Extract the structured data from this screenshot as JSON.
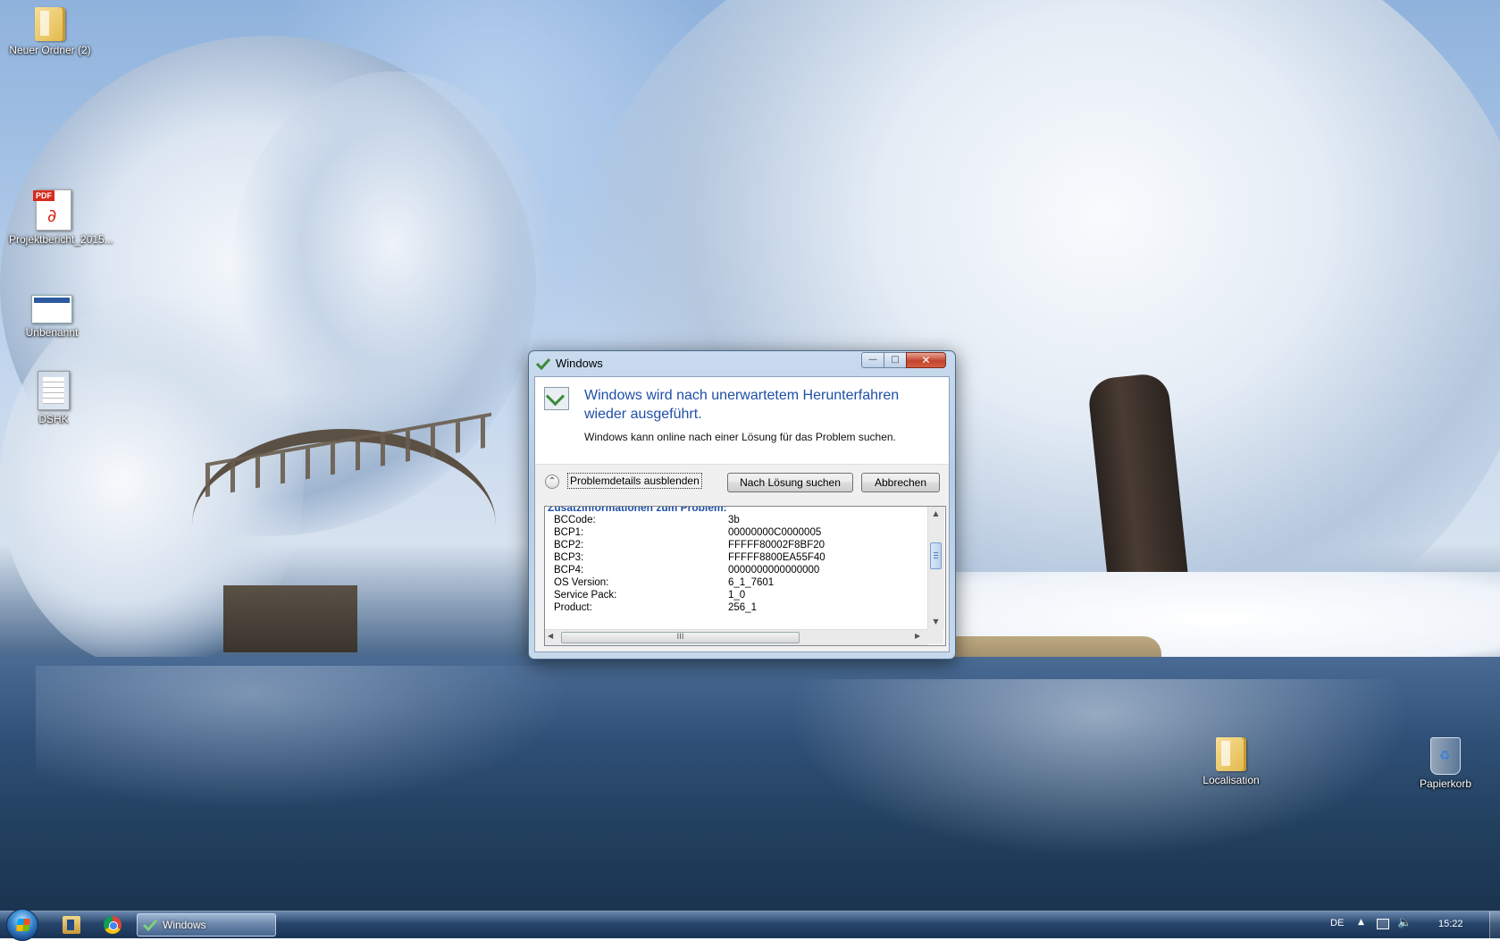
{
  "desktop": {
    "icons": [
      {
        "label": "Neuer Ordner (2)",
        "icon": "folder-icon"
      },
      {
        "label": "Projektbericht_2015...",
        "icon": "pdf-file-icon",
        "badge": "PDF"
      },
      {
        "label": "Unbenannt",
        "icon": "window-file-icon"
      },
      {
        "label": "DSHK",
        "icon": "document-file-icon"
      },
      {
        "label": "Localisation",
        "icon": "folder-icon"
      },
      {
        "label": "Papierkorb",
        "icon": "recycle-bin-icon"
      }
    ]
  },
  "dialog": {
    "title": "Windows",
    "main_instruction": "Windows wird nach unerwartetem Herunterfahren wieder ausgeführt.",
    "content": "Windows kann online nach einer Lösung für das Problem suchen.",
    "expander_label": "Problemdetails ausblenden",
    "search_button": "Nach Lösung suchen",
    "cancel_button": "Abbrechen",
    "details_header": "Zusatzinformationen zum Problem:",
    "details": [
      {
        "key": "BCCode:",
        "value": "3b"
      },
      {
        "key": "BCP1:",
        "value": "00000000C0000005"
      },
      {
        "key": "BCP2:",
        "value": "FFFFF80002F8BF20"
      },
      {
        "key": "BCP3:",
        "value": "FFFFF8800EA55F40"
      },
      {
        "key": "BCP4:",
        "value": "0000000000000000"
      },
      {
        "key": "OS Version:",
        "value": "6_1_7601"
      },
      {
        "key": "Service Pack:",
        "value": "1_0"
      },
      {
        "key": "Product:",
        "value": "256_1"
      }
    ],
    "vertical_scroll_position": 0.3,
    "close_glyph": "✕",
    "minimize_glyph": "—",
    "maximize_glyph": "□",
    "hscroll_grip": "III"
  },
  "taskbar": {
    "task_label": "Windows",
    "language": "DE",
    "clock": "15:22",
    "tray_up_glyph": "▲",
    "volume_glyph": "🔈"
  },
  "colors": {
    "instruction_blue": "#1f4fa8",
    "close_red": "#c3452f"
  }
}
